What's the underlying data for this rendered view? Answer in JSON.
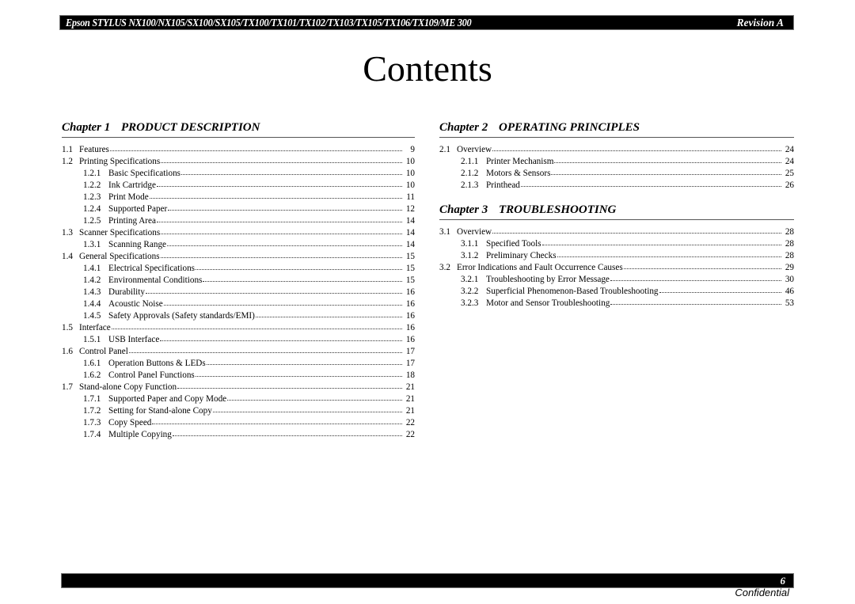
{
  "header": {
    "title": "Epson STYLUS NX100/NX105/SX100/SX105/TX100/TX101/TX102/TX103/TX105/TX106/TX109/ME 300",
    "revision": "Revision A"
  },
  "page_title": "Contents",
  "chapters": [
    {
      "number": "Chapter 1",
      "title": "PRODUCT DESCRIPTION",
      "entries": [
        {
          "num": "1.1",
          "label": "Features",
          "page": "9",
          "level": 1
        },
        {
          "num": "1.2",
          "label": "Printing Specifications",
          "page": "10",
          "level": 1
        },
        {
          "num": "1.2.1",
          "label": "Basic Specifications",
          "page": "10",
          "level": 2
        },
        {
          "num": "1.2.2",
          "label": "Ink Cartridge",
          "page": "10",
          "level": 2
        },
        {
          "num": "1.2.3",
          "label": "Print Mode",
          "page": "11",
          "level": 2
        },
        {
          "num": "1.2.4",
          "label": "Supported Paper",
          "page": "12",
          "level": 2
        },
        {
          "num": "1.2.5",
          "label": "Printing Area",
          "page": "14",
          "level": 2
        },
        {
          "num": "1.3",
          "label": "Scanner Specifications",
          "page": "14",
          "level": 1
        },
        {
          "num": "1.3.1",
          "label": "Scanning Range",
          "page": "14",
          "level": 2
        },
        {
          "num": "1.4",
          "label": "General Specifications",
          "page": "15",
          "level": 1
        },
        {
          "num": "1.4.1",
          "label": "Electrical Specifications",
          "page": "15",
          "level": 2
        },
        {
          "num": "1.4.2",
          "label": "Environmental Conditions",
          "page": "15",
          "level": 2
        },
        {
          "num": "1.4.3",
          "label": "Durability",
          "page": "16",
          "level": 2
        },
        {
          "num": "1.4.4",
          "label": "Acoustic Noise",
          "page": "16",
          "level": 2
        },
        {
          "num": "1.4.5",
          "label": "Safety Approvals (Safety standards/EMI)",
          "page": "16",
          "level": 2
        },
        {
          "num": "1.5",
          "label": "Interface",
          "page": "16",
          "level": 1
        },
        {
          "num": "1.5.1",
          "label": "USB Interface",
          "page": "16",
          "level": 2
        },
        {
          "num": "1.6",
          "label": "Control Panel",
          "page": "17",
          "level": 1
        },
        {
          "num": "1.6.1",
          "label": "Operation Buttons & LEDs",
          "page": "17",
          "level": 2
        },
        {
          "num": "1.6.2",
          "label": "Control Panel Functions",
          "page": "18",
          "level": 2
        },
        {
          "num": "1.7",
          "label": "Stand-alone Copy Function",
          "page": "21",
          "level": 1
        },
        {
          "num": "1.7.1",
          "label": "Supported Paper and Copy Mode",
          "page": "21",
          "level": 2
        },
        {
          "num": "1.7.2",
          "label": "Setting for Stand-alone Copy",
          "page": "21",
          "level": 2
        },
        {
          "num": "1.7.3",
          "label": "Copy Speed",
          "page": "22",
          "level": 2
        },
        {
          "num": "1.7.4",
          "label": "Multiple Copying",
          "page": "22",
          "level": 2
        }
      ]
    },
    {
      "number": "Chapter 2",
      "title": "OPERATING PRINCIPLES",
      "entries": [
        {
          "num": "2.1",
          "label": "Overview",
          "page": "24",
          "level": 1
        },
        {
          "num": "2.1.1",
          "label": "Printer Mechanism",
          "page": "24",
          "level": 2
        },
        {
          "num": "2.1.2",
          "label": "Motors & Sensors",
          "page": "25",
          "level": 2
        },
        {
          "num": "2.1.3",
          "label": "Printhead",
          "page": "26",
          "level": 2
        }
      ]
    },
    {
      "number": "Chapter 3",
      "title": "TROUBLESHOOTING",
      "entries": [
        {
          "num": "3.1",
          "label": "Overview",
          "page": "28",
          "level": 1
        },
        {
          "num": "3.1.1",
          "label": "Specified Tools",
          "page": "28",
          "level": 2
        },
        {
          "num": "3.1.2",
          "label": "Preliminary Checks",
          "page": "28",
          "level": 2
        },
        {
          "num": "3.2",
          "label": "Error Indications and Fault Occurrence Causes",
          "page": "29",
          "level": 1
        },
        {
          "num": "3.2.1",
          "label": "Troubleshooting by Error Message",
          "page": "30",
          "level": 2
        },
        {
          "num": "3.2.2",
          "label": "Superficial Phenomenon-Based Troubleshooting",
          "page": "46",
          "level": 2
        },
        {
          "num": "3.2.3",
          "label": "Motor and Sensor Troubleshooting",
          "page": "53",
          "level": 2
        }
      ]
    }
  ],
  "footer": {
    "page_number": "6",
    "confidential": "Confidential"
  }
}
